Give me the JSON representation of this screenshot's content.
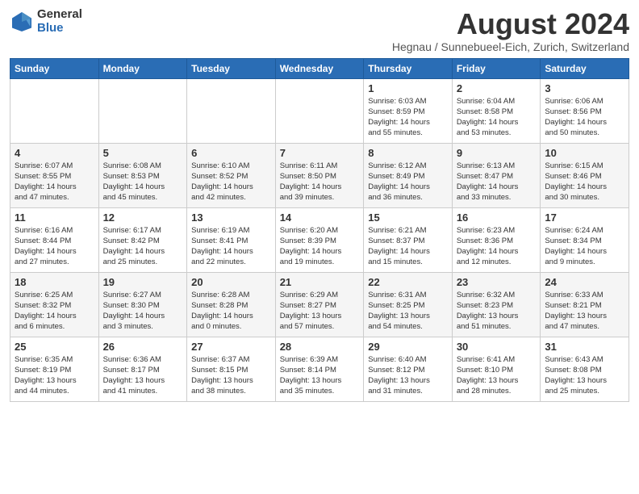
{
  "logo": {
    "general": "General",
    "blue": "Blue"
  },
  "title": "August 2024",
  "subtitle": "Hegnau / Sunnebueel-Eich, Zurich, Switzerland",
  "headers": [
    "Sunday",
    "Monday",
    "Tuesday",
    "Wednesday",
    "Thursday",
    "Friday",
    "Saturday"
  ],
  "weeks": [
    [
      {
        "day": "",
        "info": ""
      },
      {
        "day": "",
        "info": ""
      },
      {
        "day": "",
        "info": ""
      },
      {
        "day": "",
        "info": ""
      },
      {
        "day": "1",
        "info": "Sunrise: 6:03 AM\nSunset: 8:59 PM\nDaylight: 14 hours\nand 55 minutes."
      },
      {
        "day": "2",
        "info": "Sunrise: 6:04 AM\nSunset: 8:58 PM\nDaylight: 14 hours\nand 53 minutes."
      },
      {
        "day": "3",
        "info": "Sunrise: 6:06 AM\nSunset: 8:56 PM\nDaylight: 14 hours\nand 50 minutes."
      }
    ],
    [
      {
        "day": "4",
        "info": "Sunrise: 6:07 AM\nSunset: 8:55 PM\nDaylight: 14 hours\nand 47 minutes."
      },
      {
        "day": "5",
        "info": "Sunrise: 6:08 AM\nSunset: 8:53 PM\nDaylight: 14 hours\nand 45 minutes."
      },
      {
        "day": "6",
        "info": "Sunrise: 6:10 AM\nSunset: 8:52 PM\nDaylight: 14 hours\nand 42 minutes."
      },
      {
        "day": "7",
        "info": "Sunrise: 6:11 AM\nSunset: 8:50 PM\nDaylight: 14 hours\nand 39 minutes."
      },
      {
        "day": "8",
        "info": "Sunrise: 6:12 AM\nSunset: 8:49 PM\nDaylight: 14 hours\nand 36 minutes."
      },
      {
        "day": "9",
        "info": "Sunrise: 6:13 AM\nSunset: 8:47 PM\nDaylight: 14 hours\nand 33 minutes."
      },
      {
        "day": "10",
        "info": "Sunrise: 6:15 AM\nSunset: 8:46 PM\nDaylight: 14 hours\nand 30 minutes."
      }
    ],
    [
      {
        "day": "11",
        "info": "Sunrise: 6:16 AM\nSunset: 8:44 PM\nDaylight: 14 hours\nand 27 minutes."
      },
      {
        "day": "12",
        "info": "Sunrise: 6:17 AM\nSunset: 8:42 PM\nDaylight: 14 hours\nand 25 minutes."
      },
      {
        "day": "13",
        "info": "Sunrise: 6:19 AM\nSunset: 8:41 PM\nDaylight: 14 hours\nand 22 minutes."
      },
      {
        "day": "14",
        "info": "Sunrise: 6:20 AM\nSunset: 8:39 PM\nDaylight: 14 hours\nand 19 minutes."
      },
      {
        "day": "15",
        "info": "Sunrise: 6:21 AM\nSunset: 8:37 PM\nDaylight: 14 hours\nand 15 minutes."
      },
      {
        "day": "16",
        "info": "Sunrise: 6:23 AM\nSunset: 8:36 PM\nDaylight: 14 hours\nand 12 minutes."
      },
      {
        "day": "17",
        "info": "Sunrise: 6:24 AM\nSunset: 8:34 PM\nDaylight: 14 hours\nand 9 minutes."
      }
    ],
    [
      {
        "day": "18",
        "info": "Sunrise: 6:25 AM\nSunset: 8:32 PM\nDaylight: 14 hours\nand 6 minutes."
      },
      {
        "day": "19",
        "info": "Sunrise: 6:27 AM\nSunset: 8:30 PM\nDaylight: 14 hours\nand 3 minutes."
      },
      {
        "day": "20",
        "info": "Sunrise: 6:28 AM\nSunset: 8:28 PM\nDaylight: 14 hours\nand 0 minutes."
      },
      {
        "day": "21",
        "info": "Sunrise: 6:29 AM\nSunset: 8:27 PM\nDaylight: 13 hours\nand 57 minutes."
      },
      {
        "day": "22",
        "info": "Sunrise: 6:31 AM\nSunset: 8:25 PM\nDaylight: 13 hours\nand 54 minutes."
      },
      {
        "day": "23",
        "info": "Sunrise: 6:32 AM\nSunset: 8:23 PM\nDaylight: 13 hours\nand 51 minutes."
      },
      {
        "day": "24",
        "info": "Sunrise: 6:33 AM\nSunset: 8:21 PM\nDaylight: 13 hours\nand 47 minutes."
      }
    ],
    [
      {
        "day": "25",
        "info": "Sunrise: 6:35 AM\nSunset: 8:19 PM\nDaylight: 13 hours\nand 44 minutes."
      },
      {
        "day": "26",
        "info": "Sunrise: 6:36 AM\nSunset: 8:17 PM\nDaylight: 13 hours\nand 41 minutes."
      },
      {
        "day": "27",
        "info": "Sunrise: 6:37 AM\nSunset: 8:15 PM\nDaylight: 13 hours\nand 38 minutes."
      },
      {
        "day": "28",
        "info": "Sunrise: 6:39 AM\nSunset: 8:14 PM\nDaylight: 13 hours\nand 35 minutes."
      },
      {
        "day": "29",
        "info": "Sunrise: 6:40 AM\nSunset: 8:12 PM\nDaylight: 13 hours\nand 31 minutes."
      },
      {
        "day": "30",
        "info": "Sunrise: 6:41 AM\nSunset: 8:10 PM\nDaylight: 13 hours\nand 28 minutes."
      },
      {
        "day": "31",
        "info": "Sunrise: 6:43 AM\nSunset: 8:08 PM\nDaylight: 13 hours\nand 25 minutes."
      }
    ]
  ]
}
